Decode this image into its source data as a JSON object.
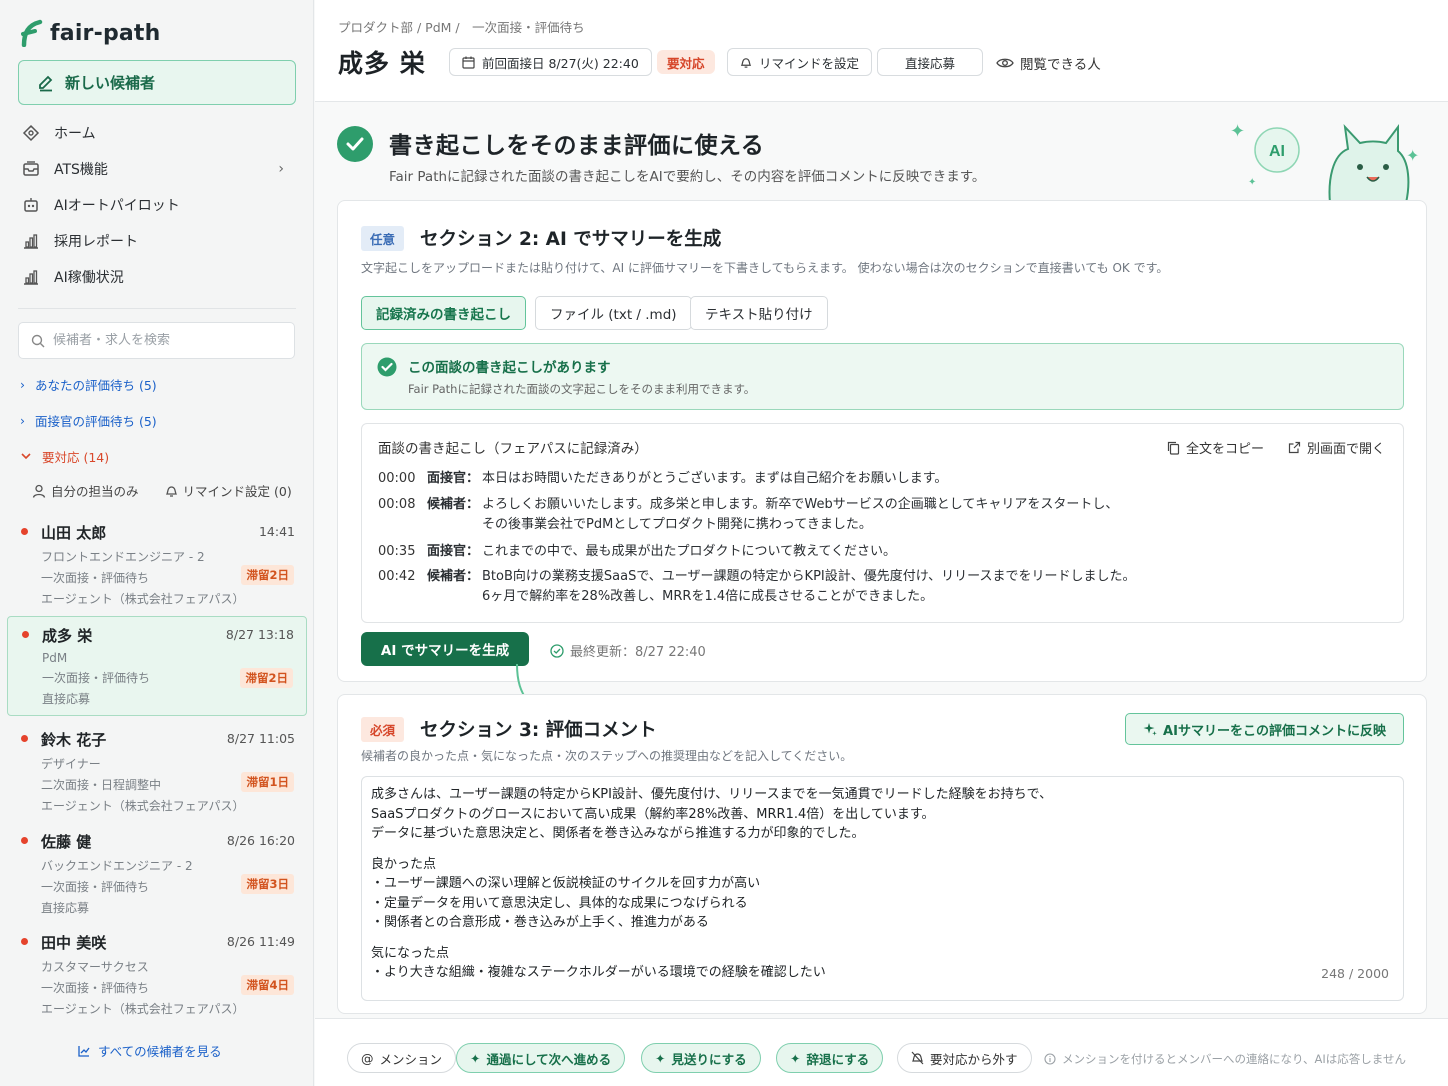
{
  "app": {
    "name": "fair-path",
    "accent": "#2e9d6c",
    "brand_green": "#17704a"
  },
  "sidebar": {
    "new_candidate": "新しい候補者",
    "nav": [
      {
        "label": "ホーム",
        "icon": "home-icon"
      },
      {
        "label": "ATS機能",
        "icon": "inbox-icon",
        "has_chevron": true
      },
      {
        "label": "AIオートパイロット",
        "icon": "robot-icon"
      },
      {
        "label": "採用レポート",
        "icon": "bar-chart-icon"
      },
      {
        "label": "AI稼働状況",
        "icon": "bar-chart-icon"
      }
    ],
    "search_placeholder": "候補者・求人を検索",
    "groups": [
      {
        "label": "あなたの評価待ち (5)",
        "expanded": false
      },
      {
        "label": "面接官の評価待ち (5)",
        "expanded": false
      },
      {
        "label": "要対応 (14)",
        "expanded": true
      }
    ],
    "filters": {
      "mine": "自分の担当のみ",
      "reminder": "リマインド設定 (0)"
    },
    "candidates": [
      {
        "name": "山田 太郎",
        "time": "14:41",
        "role": "フロントエンドエンジニア - 2",
        "stage": "一次面接・評価待ち",
        "source": "エージェント（株式会社フェアパス）",
        "stay": "滞留2日"
      },
      {
        "name": "成多 栄",
        "time": "8/27 13:18",
        "role": "PdM",
        "stage": "一次面接・評価待ち",
        "source": "直接応募",
        "stay": "滞留2日",
        "selected": true
      },
      {
        "name": "鈴木 花子",
        "time": "8/27 11:05",
        "role": "デザイナー",
        "stage": "二次面接・日程調整中",
        "source": "エージェント（株式会社フェアパス）",
        "stay": "滞留1日"
      },
      {
        "name": "佐藤 健",
        "time": "8/26 16:20",
        "role": "バックエンドエンジニア - 2",
        "stage": "一次面接・評価待ち",
        "source": "直接応募",
        "stay": "滞留3日"
      },
      {
        "name": "田中 美咲",
        "time": "8/26 11:49",
        "role": "カスタマーサクセス",
        "stage": "一次面接・評価待ち",
        "source": "エージェント（株式会社フェアパス）",
        "stay": "滞留4日"
      }
    ],
    "see_all": "すべての候補者を見る"
  },
  "header": {
    "breadcrumb": "プロダクト部 / PdM /　一次面接・評価待ち",
    "candidate_name": "成多 栄",
    "last_interview": "前回面接日 8/27(火) 22:40",
    "status": "要対応",
    "reminder": "リマインドを設定",
    "source": "直接応募",
    "viewers": "閲覧できる人"
  },
  "hero": {
    "title": "書き起こしをそのまま評価に使える",
    "subtitle": "Fair Pathに記録された面談の書き起こしをAIで要約し、その内容を評価コメントに反映できます。",
    "mascot_badge": "AI"
  },
  "section2": {
    "badge": "任意",
    "title": "セクション 2: AI でサマリーを生成",
    "desc": "文字起こしをアップロードまたは貼り付けて、AI に評価サマリーを下書きしてもらえます。 使わない場合は次のセクションで直接書いても OK です。",
    "tabs": [
      "記録済みの書き起こし",
      "ファイル (txt / .md)",
      "テキスト貼り付け"
    ],
    "notice_title": "この面談の書き起こしがあります",
    "notice_sub": "Fair Pathに記録された面談の文字起こしをそのまま利用できます。",
    "transcript_head": "面談の書き起こし（フェアパスに記録済み）",
    "copy_all": "全文をコピー",
    "open_new": "別画面で開く",
    "transcript": [
      {
        "time": "00:00",
        "speaker": "面接官：",
        "lines": [
          "本日はお時間いただきありがとうございます。まずは自己紹介をお願いします。"
        ]
      },
      {
        "time": "00:08",
        "speaker": "候補者：",
        "lines": [
          "よろしくお願いいたします。成多栄と申します。新卒でWebサービスの企画職としてキャリアをスタートし、",
          "その後事業会社でPdMとしてプロダクト開発に携わってきました。"
        ]
      },
      {
        "time": "00:35",
        "speaker": "面接官：",
        "lines": [
          "これまでの中で、最も成果が出たプロダクトについて教えてください。"
        ]
      },
      {
        "time": "00:42",
        "speaker": "候補者：",
        "lines": [
          "BtoB向けの業務支援SaaSで、ユーザー課題の特定からKPI設計、優先度付け、リリースまでをリードしました。",
          "6ヶ月で解約率を28%改善し、MRRを1.4倍に成長させることができました。"
        ]
      }
    ],
    "generate": "AI でサマリーを生成",
    "last_updated": "最終更新：8/27 22:40"
  },
  "section3": {
    "badge": "必須",
    "title": "セクション 3: 評価コメント",
    "desc": "候補者の良かった点・気になった点・次のステップへの推奨理由などを記入してください。",
    "reflect": "AIサマリーをこの評価コメントに反映",
    "comment": {
      "intro": [
        "成多さんは、ユーザー課題の特定からKPI設計、優先度付け、リリースまでを一気通貫でリードした経験をお持ちで、",
        "SaaSプロダクトのグロースにおいて高い成果（解約率28%改善、MRR1.4倍）を出しています。",
        "データに基づいた意思決定と、関係者を巻き込みながら推進する力が印象的でした。"
      ],
      "good_head": "良かった点",
      "good": [
        "・ユーザー課題への深い理解と仮説検証のサイクルを回す力が高い",
        "・定量データを用いて意思決定し、具体的な成果につなげられる",
        "・関係者との合意形成・巻き込みが上手く、推進力がある"
      ],
      "concern_head": "気になった点",
      "concern": [
        "・より大きな組織・複雑なステークホルダーがいる環境での経験を確認したい"
      ]
    },
    "counter": "248 / 2000"
  },
  "bottom": {
    "mention": "メンション",
    "pass": "通過にして次へ進める",
    "hold": "見送りにする",
    "decline": "辞退にする",
    "remove": "要対応から外す",
    "hint": "メンションを付けるとメンバーへの連絡になり、AIは応答しません"
  }
}
